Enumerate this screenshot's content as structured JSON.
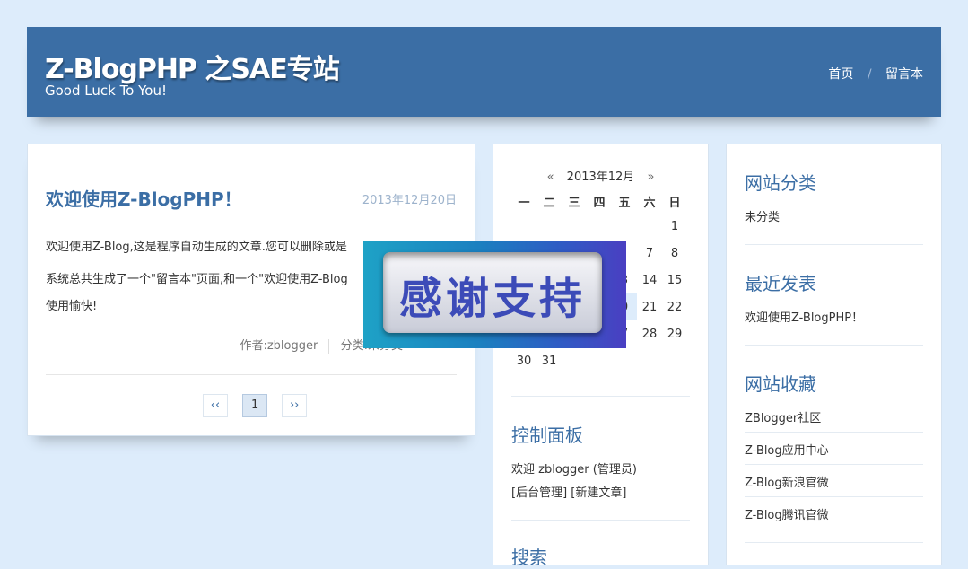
{
  "header": {
    "site_title": "Z-BlogPHP 之SAE专站",
    "subtitle": "Good Luck To You!",
    "nav": [
      {
        "label": "首页"
      },
      {
        "label": "留言本"
      }
    ],
    "nav_separator": "/"
  },
  "post": {
    "title": "欢迎使用Z-BlogPHP！",
    "date": "2013年12月20日",
    "paragraph1": "欢迎使用Z-Blog,这是程序自动生成的文章.您可以删除或是",
    "paragraph2_line1": "系统总共生成了一个\"留言本\"页面,和一个\"欢迎使用Z-Blog",
    "paragraph2_line2": "使用愉快!",
    "author": "作者:zblogger",
    "category": "分类:未分类"
  },
  "pagination": {
    "prev": "‹‹",
    "current": "1",
    "next": "››"
  },
  "calendar": {
    "prev": "«",
    "title": "2013年12月",
    "next": "»",
    "weekdays": [
      "一",
      "二",
      "三",
      "四",
      "五",
      "六",
      "日"
    ],
    "rows": [
      [
        "",
        "",
        "",
        "",
        "",
        "",
        "1"
      ],
      [
        "",
        "",
        "",
        "",
        "",
        "7",
        "8"
      ],
      [
        "",
        "",
        "",
        "",
        "3",
        "14",
        "15"
      ],
      [
        "",
        "",
        "",
        "",
        "0",
        "21",
        "22"
      ],
      [
        "",
        "",
        "",
        "",
        "7",
        "28",
        "29"
      ],
      [
        "30",
        "31",
        "",
        "",
        "",
        "",
        ""
      ]
    ]
  },
  "control_panel": {
    "heading": "控制面板",
    "welcome": "欢迎 zblogger (管理员)",
    "admin_link": "[后台管理]",
    "new_post_link": "[新建文章]"
  },
  "search": {
    "heading": "搜索"
  },
  "categories": {
    "heading": "网站分类",
    "items": [
      "未分类"
    ]
  },
  "recent": {
    "heading": "最近发表",
    "items": [
      "欢迎使用Z-BlogPHP！"
    ]
  },
  "favorites": {
    "heading": "网站收藏",
    "items": [
      "ZBlogger社区",
      "Z-Blog应用中心",
      "Z-Blog新浪官微",
      "Z-Blog腾讯官微"
    ]
  },
  "popup": {
    "text": "感谢支持"
  },
  "colors": {
    "header_bg": "#3b6ea5",
    "page_bg": "#ddecfb",
    "accent": "#3b6ea5"
  }
}
